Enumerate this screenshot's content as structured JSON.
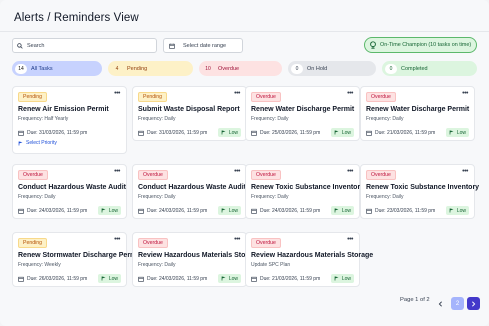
{
  "header": {
    "title": "Alerts / Reminders View"
  },
  "search": {
    "placeholder": "Search"
  },
  "date_filter": {
    "placeholder": "Select date range"
  },
  "champion": {
    "text": "On-Time Champion (10 tasks on time)"
  },
  "tabs": [
    {
      "count": "14",
      "label": "All Tasks"
    },
    {
      "count": "4",
      "label": "Pending"
    },
    {
      "count": "10",
      "label": "Overdue"
    },
    {
      "count": "0",
      "label": "On Hold"
    },
    {
      "count": "0",
      "label": "Completed"
    }
  ],
  "cards": [
    {
      "status": "Pending",
      "title": "Renew Air Emission Permit",
      "frequency": "Frequency: Half Yearly",
      "due": "Due: 31/03/2026, 11:59 pm",
      "priority": "",
      "action": "Select Priority"
    },
    {
      "status": "Pending",
      "title": "Submit Waste Disposal Report",
      "frequency": "Frequency: Daily",
      "due": "Due: 31/03/2026, 11:59 pm",
      "priority": "Low",
      "action": ""
    },
    {
      "status": "Overdue",
      "title": "Renew Water Discharge Permit",
      "frequency": "Frequency: Daily",
      "due": "Due: 25/03/2026, 11:59 pm",
      "priority": "Low",
      "action": ""
    },
    {
      "status": "Overdue",
      "title": "Renew Water Discharge Permit",
      "frequency": "Frequency: Daily",
      "due": "Due: 21/03/2026, 11:59 pm",
      "priority": "Low",
      "action": ""
    },
    {
      "status": "Overdue",
      "title": "Conduct Hazardous Waste Audit",
      "frequency": "Frequency: Daily",
      "due": "Due: 24/03/2026, 11:59 pm",
      "priority": "Low",
      "action": ""
    },
    {
      "status": "Overdue",
      "title": "Conduct Hazardous Waste Audit",
      "frequency": "Frequency: Daily",
      "due": "Due: 24/03/2026, 11:59 pm",
      "priority": "Low",
      "action": ""
    },
    {
      "status": "Overdue",
      "title": "Renew Toxic Substance Inventory",
      "frequency": "Frequency: Daily",
      "due": "Due: 24/03/2026, 11:59 pm",
      "priority": "Low",
      "action": ""
    },
    {
      "status": "Overdue",
      "title": "Renew Toxic Substance Inventory",
      "frequency": "Frequency: Daily",
      "due": "Due: 23/03/2026, 11:59 pm",
      "priority": "Low",
      "action": ""
    },
    {
      "status": "Pending",
      "title": "Renew Stormwater Discharge Permit",
      "frequency": "Frequency: Weekly",
      "due": "Due: 26/03/2026, 11:59 pm",
      "priority": "Low",
      "action": ""
    },
    {
      "status": "Overdue",
      "title": "Review Hazardous Materials Storage",
      "frequency": "Frequency: Daily",
      "due": "Due: 24/03/2026, 11:59 pm",
      "priority": "Low",
      "action": ""
    },
    {
      "status": "Overdue",
      "title": "Review Hazardous Materials Storage",
      "frequency": "Update SPC Plan",
      "due": "Due: 21/03/2026, 11:59 pm",
      "priority": "Low",
      "action": ""
    }
  ],
  "pagination": {
    "label": "Page 1 of 2",
    "current": "2"
  },
  "colors": {
    "accent": "#4f46e5",
    "pending": "#b45309",
    "overdue": "#be123c",
    "low": "#166534"
  }
}
